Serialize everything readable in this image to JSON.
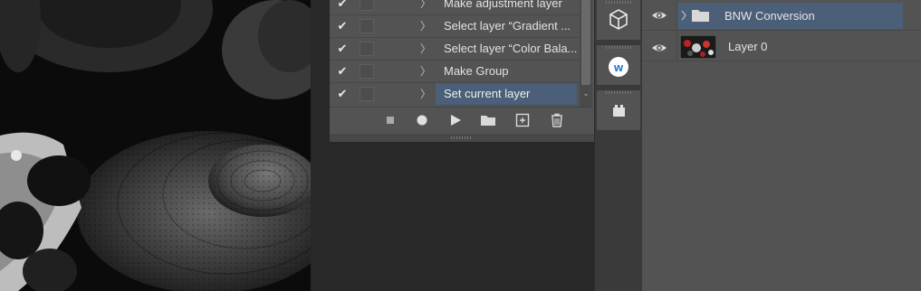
{
  "actions": {
    "items": [
      {
        "label": "Make adjustment layer",
        "checked": true,
        "selected": false
      },
      {
        "label": "Select layer “Gradient ...",
        "checked": true,
        "selected": false
      },
      {
        "label": "Select layer “Color Bala...",
        "checked": true,
        "selected": false
      },
      {
        "label": "Make Group",
        "checked": true,
        "selected": false
      },
      {
        "label": "Set current layer",
        "checked": true,
        "selected": true
      }
    ],
    "check_glyph": "✔",
    "expander_glyph": "〉",
    "scroll_arrow": "⌄",
    "toolbar_icons": [
      "stop-icon",
      "record-icon",
      "play-icon",
      "folder-icon",
      "new-action-icon",
      "trash-icon"
    ]
  },
  "dock": {
    "icons": [
      "3d-cube-icon",
      "wacom-w-icon",
      "plugin-lego-icon"
    ],
    "wacom_letter": "w"
  },
  "layers": {
    "items": [
      {
        "name": "BNW Conversion",
        "type": "group",
        "selected": true
      },
      {
        "name": "Layer 0",
        "type": "pixel",
        "selected": false
      }
    ]
  },
  "colors": {
    "selection": "#4b5f78",
    "panel": "#535353",
    "workspace": "#282828"
  }
}
